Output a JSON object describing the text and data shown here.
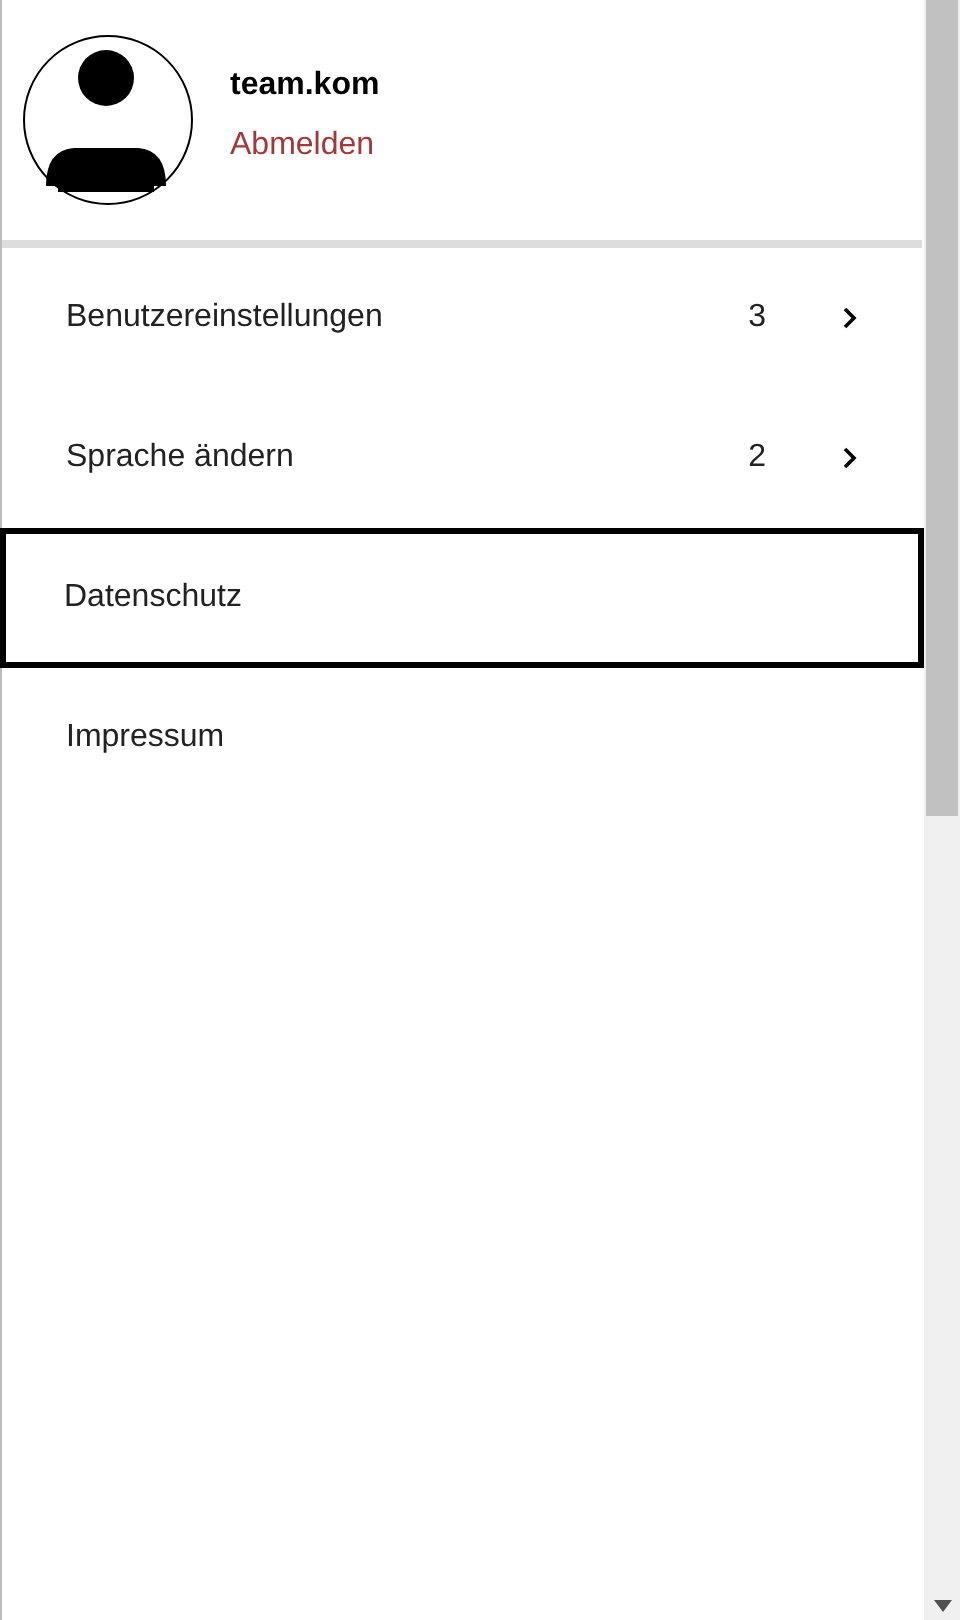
{
  "user": {
    "name": "team.kom",
    "logout": "Abmelden"
  },
  "menu": [
    {
      "label": "Benutzereinstellungen",
      "count": "3",
      "submenu": true,
      "focused": false
    },
    {
      "label": "Sprache ändern",
      "count": "2",
      "submenu": true,
      "focused": false
    },
    {
      "label": "Datenschutz",
      "submenu": false,
      "focused": true
    },
    {
      "label": "Impressum",
      "submenu": false,
      "focused": false
    }
  ]
}
